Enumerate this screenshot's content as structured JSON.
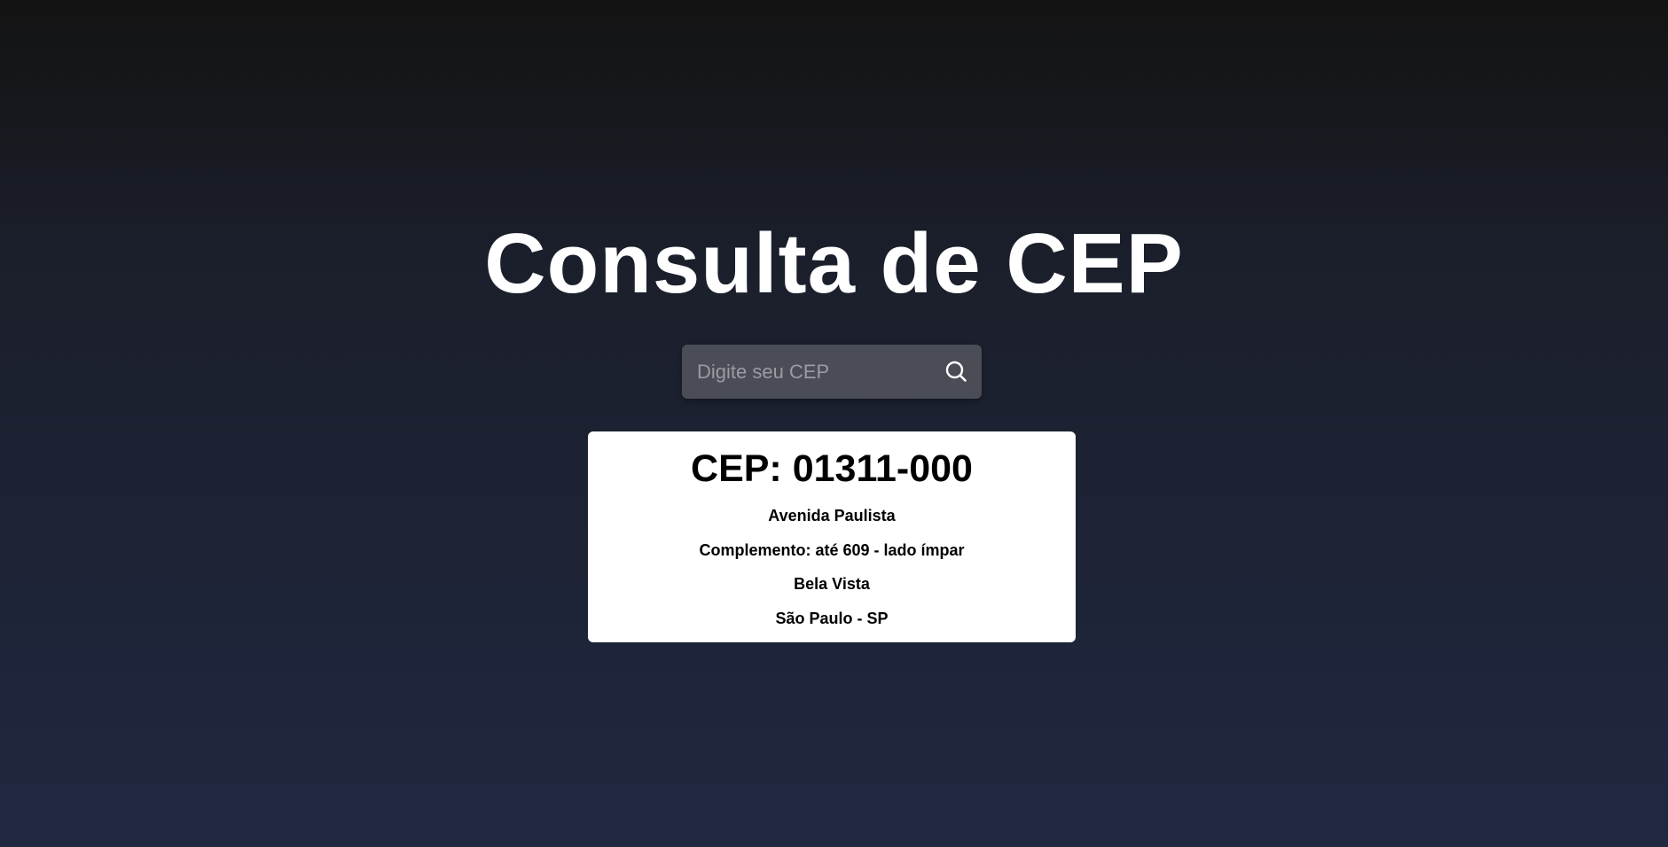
{
  "page": {
    "title": "Consulta de CEP"
  },
  "search": {
    "placeholder": "Digite seu CEP",
    "value": "",
    "icon": "search-icon"
  },
  "result": {
    "cep_label": "CEP: 01311-000",
    "logradouro": "Avenida Paulista",
    "complemento": "Complemento: até 609 - lado ímpar",
    "bairro": "Bela Vista",
    "cidade_uf": "São Paulo - SP"
  },
  "colors": {
    "background_top": "#131313",
    "background_bottom": "#202842",
    "search_bg": "#4a4c56",
    "card_bg": "#ffffff",
    "title_text": "#ffffff"
  }
}
